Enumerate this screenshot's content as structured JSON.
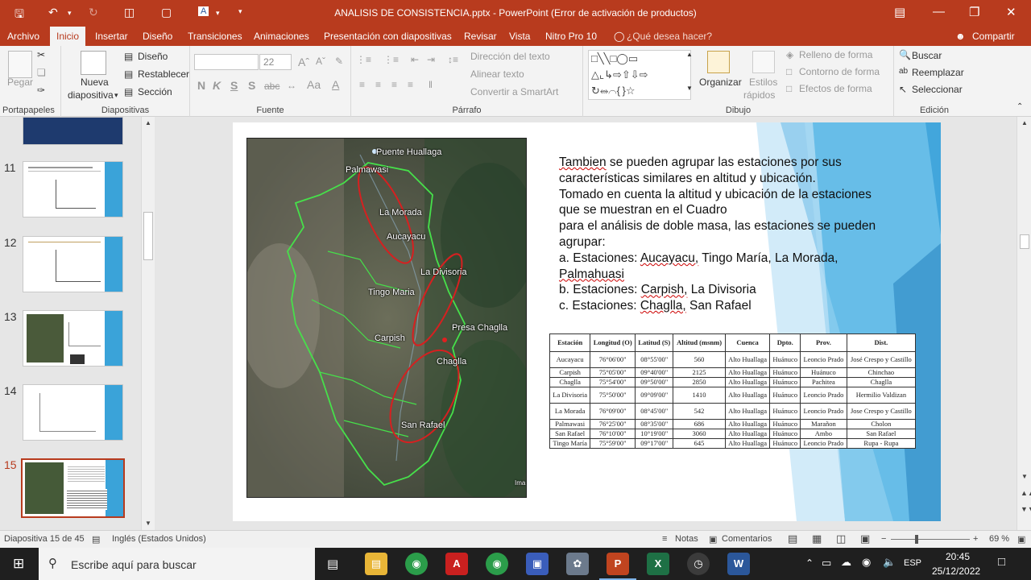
{
  "window": {
    "title": "ANALISIS DE CONSISTENCIA.pptx - PowerPoint (Error de activación de productos)"
  },
  "ribbon_tabs": [
    "Archivo",
    "Inicio",
    "Insertar",
    "Diseño",
    "Transiciones",
    "Animaciones",
    "Presentación con diapositivas",
    "Revisar",
    "Vista",
    "Nitro Pro 10"
  ],
  "tell_me": "¿Qué desea hacer?",
  "share": "Compartir",
  "ribbon": {
    "clipboard": {
      "paste": "Pegar",
      "label": "Portapapeles"
    },
    "slides": {
      "new_slide_1": "Nueva",
      "new_slide_2": "diapositiva",
      "layout": "Diseño",
      "reset": "Restablecer",
      "section": "Sección",
      "label": "Diapositivas"
    },
    "font": {
      "size": "22",
      "bold": "N",
      "italic": "K",
      "underline": "S",
      "shadow": "S",
      "strike": "abc",
      "label": "Fuente"
    },
    "paragraph": {
      "text_direction": "Dirección del texto",
      "align_text": "Alinear texto",
      "smartart": "Convertir a SmartArt",
      "label": "Párrafo"
    },
    "drawing": {
      "arrange": "Organizar",
      "styles_1": "Estilos",
      "styles_2": "rápidos",
      "fill": "Relleno de forma",
      "outline": "Contorno de forma",
      "effects": "Efectos de forma",
      "label": "Dibujo"
    },
    "editing": {
      "find": "Buscar",
      "replace": "Reemplazar",
      "select": "Seleccionar",
      "label": "Edición"
    }
  },
  "thumbnails": [
    {
      "num": "11"
    },
    {
      "num": "12"
    },
    {
      "num": "13"
    },
    {
      "num": "14"
    },
    {
      "num": "15"
    }
  ],
  "slide": {
    "text_lines": [
      [
        "Tambien",
        " se pueden agrupar las estaciones por sus"
      ],
      [
        "características similares en altitud y ubicación.",
        ""
      ],
      [
        "Tomado en cuenta la altitud y ubicación de la estaciones",
        ""
      ],
      [
        "que se muestran en el Cuadro",
        ""
      ],
      [
        "para el análisis de doble masa, las estaciones se pueden",
        ""
      ],
      [
        "agrupar:",
        ""
      ],
      [
        "a. Estaciones: ",
        "Aucayacu, Tingo María, La Morada,"
      ],
      [
        "Palmahuasi",
        ""
      ],
      [
        "b. Estaciones: ",
        "Carpish, La Divisoria"
      ],
      [
        "c. Estaciones: ",
        "Chaglla, San Rafael"
      ]
    ],
    "map_labels": {
      "puente": "Puente Huallaga",
      "palmawasi": "Palmawasi",
      "morada": "La Morada",
      "aucayacu": "Aucayacu",
      "divisoria": "La Divisoria",
      "tingo": "Tingo Maria",
      "presa": "Presa Chaglla",
      "carpish": "Carpish",
      "chaglla": "Chaglla",
      "rafael": "San Rafael",
      "ima": "Ima"
    },
    "table": {
      "headers": [
        "Estación",
        "Longitud (O)",
        "Latitud (S)",
        "Altitud (msnm)",
        "Cuenca",
        "Dpto.",
        "Prov.",
        "Dist."
      ],
      "rows": [
        [
          "Aucayacu",
          "76°06'00\"",
          "08°55'00\"",
          "560",
          "Alto Huallaga",
          "Huánuco",
          "Leoncio Prado",
          "José Crespo y Castillo"
        ],
        [
          "Carpish",
          "75°05'00\"",
          "09°40'00\"",
          "2125",
          "Alto Huallaga",
          "Huánuco",
          "Huánuco",
          "Chinchao"
        ],
        [
          "Chaglla",
          "75°54'00\"",
          "09°50'00\"",
          "2850",
          "Alto Huallaga",
          "Huánuco",
          "Pachitea",
          "Chaglla"
        ],
        [
          "La Divisoria",
          "75°50'00\"",
          "09°09'00\"",
          "1410",
          "Alto Huallaga",
          "Huánuco",
          "Leoncio Prado",
          "Hermilio Valdizan"
        ],
        [
          "La Morada",
          "76°09'00\"",
          "08°45'00\"",
          "542",
          "Alto Huallaga",
          "Huánuco",
          "Leoncio Prado",
          "Jose Crespo y Castillo"
        ],
        [
          "Palmawasi",
          "76°25'00\"",
          "08°35'00\"",
          "686",
          "Alto Huallaga",
          "Huánuco",
          "Marañon",
          "Cholon"
        ],
        [
          "San Rafael",
          "76°10'00\"",
          "10°19'00\"",
          "3060",
          "Alto Huallaga",
          "Huánuco",
          "Ambo",
          "San Rafael"
        ],
        [
          "Tingo María",
          "75°59'00\"",
          "09°17'00\"",
          "645",
          "Alto Huallaga",
          "Huánuco",
          "Leoncio Prado",
          "Rupa - Rupa"
        ]
      ]
    }
  },
  "status": {
    "slide_info": "Diapositiva 15 de 45",
    "language": "Inglés (Estados Unidos)",
    "notes": "Notas",
    "comments": "Comentarios",
    "zoom": "69 %"
  },
  "taskbar": {
    "search_placeholder": "Escribe aquí para buscar",
    "lang": "ESP",
    "time": "20:45",
    "date": "25/12/2022"
  }
}
